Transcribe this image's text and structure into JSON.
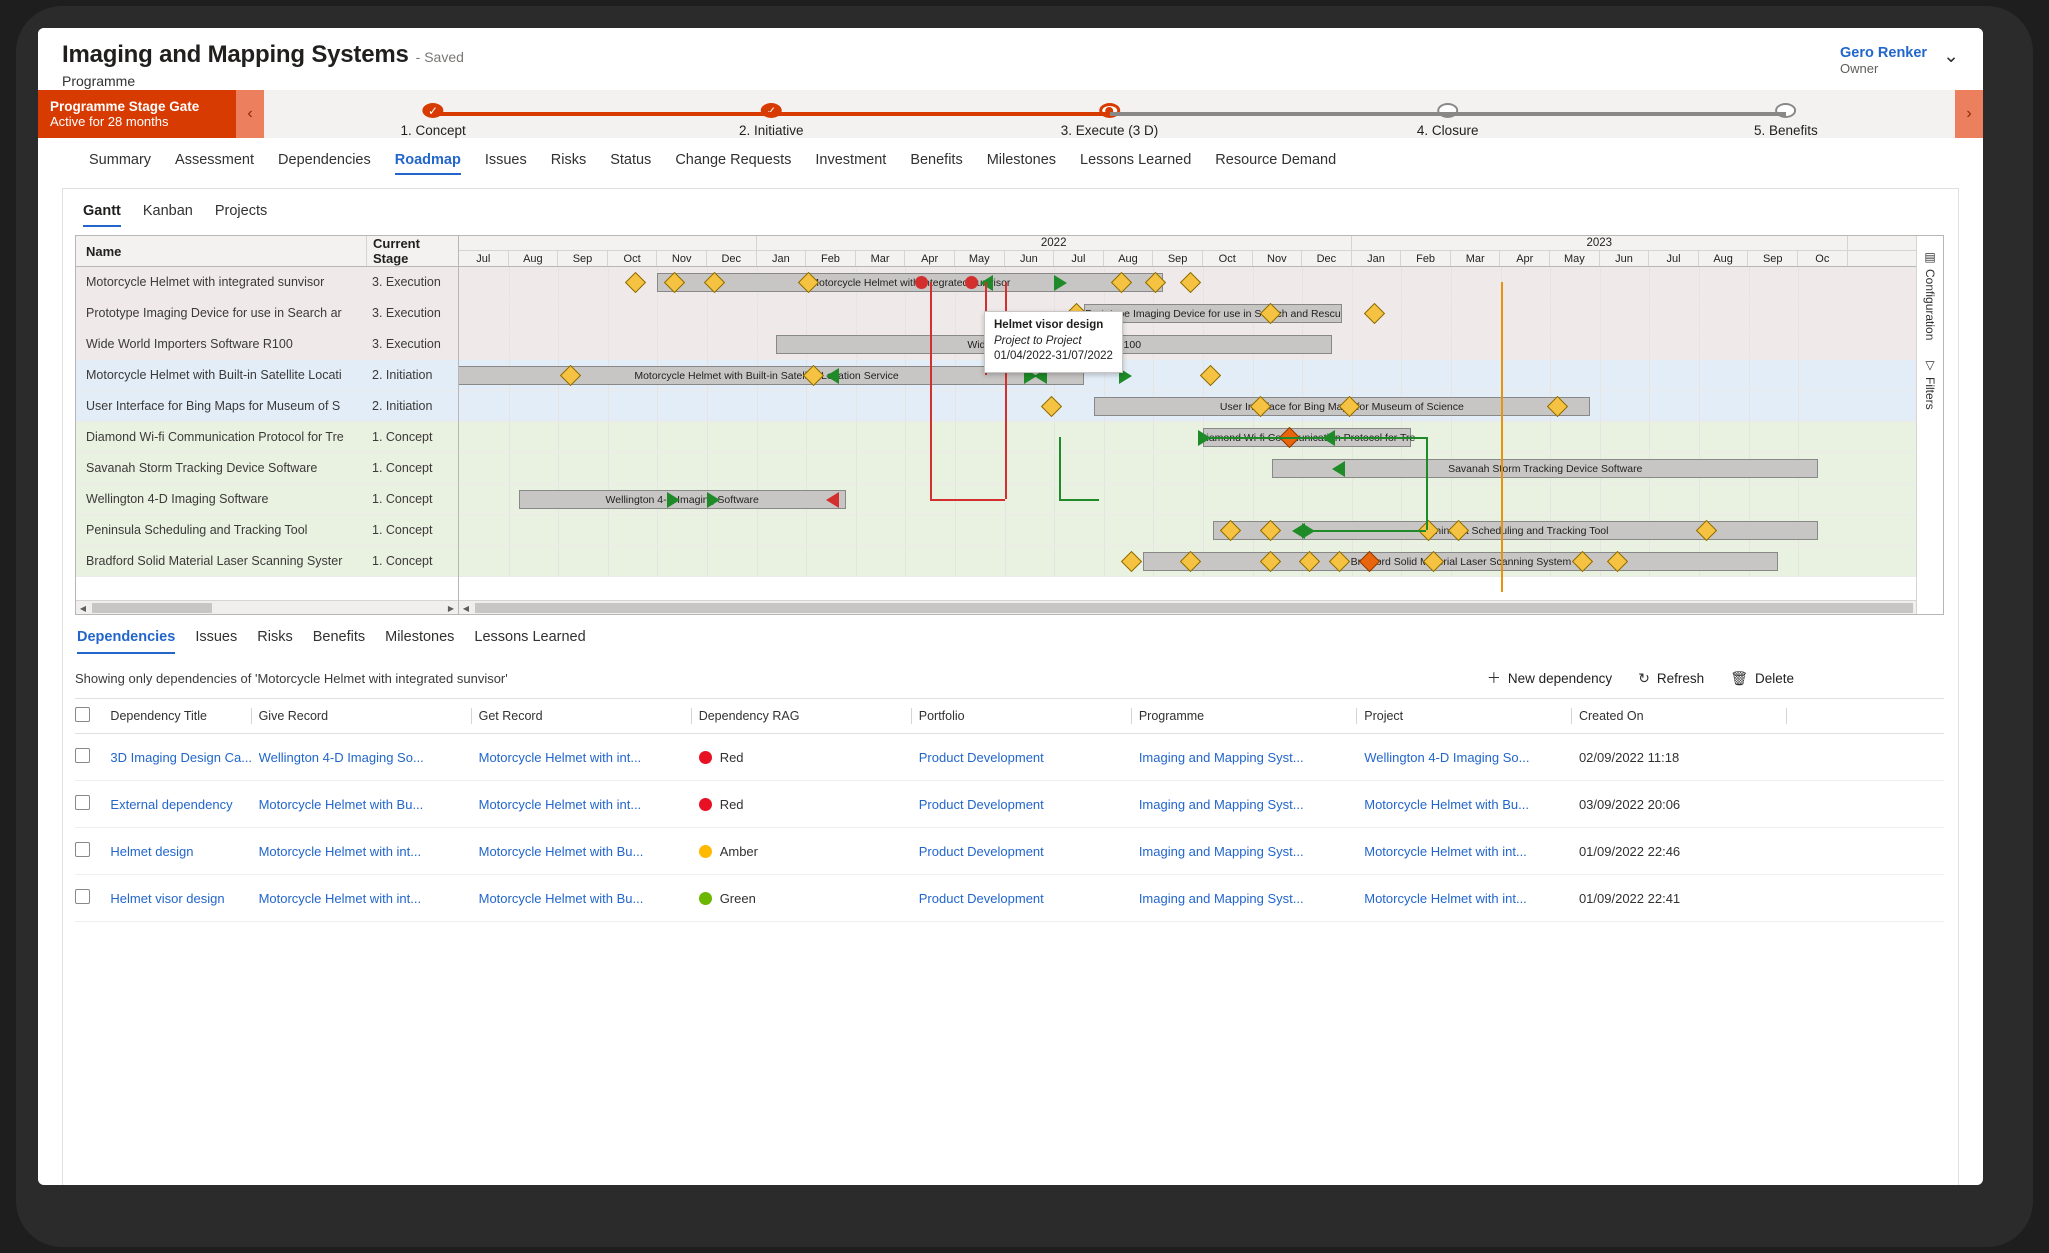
{
  "header": {
    "record_title": "Imaging and Mapping Systems",
    "saved_label": "- Saved",
    "record_type": "Programme",
    "owner_name": "Gero Renker",
    "owner_role": "Owner",
    "owner_chevron": "chevron-down-icon"
  },
  "stage_gate": {
    "label": "Programme Stage Gate",
    "sublabel": "Active for 28 months",
    "prev_icon": "‹",
    "next_icon": "›",
    "stages": [
      {
        "label": "1. Concept",
        "state": "done",
        "glyph": "✓"
      },
      {
        "label": "2. Initiative",
        "state": "done",
        "glyph": "✓"
      },
      {
        "label": "3. Execute  (3 D)",
        "state": "current",
        "glyph": ""
      },
      {
        "label": "4. Closure",
        "state": "todo",
        "glyph": ""
      },
      {
        "label": "5. Benefits",
        "state": "todo",
        "glyph": ""
      }
    ]
  },
  "nav_tabs": [
    {
      "label": "Summary",
      "active": false
    },
    {
      "label": "Assessment",
      "active": false
    },
    {
      "label": "Dependencies",
      "active": false
    },
    {
      "label": "Roadmap",
      "active": true
    },
    {
      "label": "Issues",
      "active": false
    },
    {
      "label": "Risks",
      "active": false
    },
    {
      "label": "Status",
      "active": false
    },
    {
      "label": "Change Requests",
      "active": false
    },
    {
      "label": "Investment",
      "active": false
    },
    {
      "label": "Benefits",
      "active": false
    },
    {
      "label": "Milestones",
      "active": false
    },
    {
      "label": "Lessons Learned",
      "active": false
    },
    {
      "label": "Resource Demand",
      "active": false
    }
  ],
  "roadmap": {
    "view_tabs": [
      {
        "label": "Gantt",
        "active": true
      },
      {
        "label": "Kanban",
        "active": false
      },
      {
        "label": "Projects",
        "active": false
      }
    ],
    "grid_headers": {
      "name": "Name",
      "stage": "Current Stage"
    },
    "rows": [
      {
        "name": "Motorcycle Helmet with integrated sunvisor",
        "stage": "3. Execution",
        "tier": "exec"
      },
      {
        "name": "Prototype Imaging Device for use in Search ar",
        "stage": "3. Execution",
        "tier": "exec"
      },
      {
        "name": "Wide World Importers Software R100",
        "stage": "3. Execution",
        "tier": "exec"
      },
      {
        "name": "Motorcycle Helmet with Built-in Satellite Locati",
        "stage": "2. Initiation",
        "tier": "init"
      },
      {
        "name": "User Interface for Bing Maps for Museum of S",
        "stage": "2. Initiation",
        "tier": "init"
      },
      {
        "name": "Diamond Wi-fi Communication Protocol for Tre",
        "stage": "1. Concept",
        "tier": "conc"
      },
      {
        "name": "Savanah Storm Tracking Device Software",
        "stage": "1. Concept",
        "tier": "conc"
      },
      {
        "name": "Wellington 4-D Imaging Software",
        "stage": "1. Concept",
        "tier": "conc"
      },
      {
        "name": "Peninsula Scheduling and Tracking Tool",
        "stage": "1. Concept",
        "tier": "conc"
      },
      {
        "name": "Bradford Solid Material Laser Scanning Syster",
        "stage": "1. Concept",
        "tier": "conc"
      }
    ],
    "timeline": {
      "years": [
        {
          "label": "",
          "months": 6
        },
        {
          "label": "2022",
          "months": 12
        },
        {
          "label": "2023",
          "months": 10
        }
      ],
      "months": [
        "Jul",
        "Aug",
        "Sep",
        "Oct",
        "Nov",
        "Dec",
        "Jan",
        "Feb",
        "Mar",
        "Apr",
        "May",
        "Jun",
        "Jul",
        "Aug",
        "Sep",
        "Oct",
        "Nov",
        "Dec",
        "Jan",
        "Feb",
        "Mar",
        "Apr",
        "May",
        "Jun",
        "Jul",
        "Aug",
        "Sep",
        "Oc"
      ]
    },
    "bars": [
      {
        "row": 0,
        "start": 4.0,
        "span": 10.2,
        "label": "Motorcycle Helmet with integrated sunvisor"
      },
      {
        "row": 1,
        "start": 12.6,
        "span": 5.2,
        "label": "Prototype Imaging Device for use in Search and Rescu"
      },
      {
        "row": 2,
        "start": 6.4,
        "span": 11.2,
        "label": "Wide World Importers Software R100"
      },
      {
        "row": 3,
        "start": -0.2,
        "span": 12.8,
        "label": "Motorcycle Helmet with Built-in Satellite Location Service"
      },
      {
        "row": 4,
        "start": 12.8,
        "span": 10.0,
        "label": "User Interface for Bing Maps for Museum of Science"
      },
      {
        "row": 5,
        "start": 15.0,
        "span": 4.2,
        "label": "Diamond Wi-fi Communication Protocol for Tre"
      },
      {
        "row": 6,
        "start": 16.4,
        "span": 11.0,
        "label": "Savanah Storm Tracking Device Software"
      },
      {
        "row": 7,
        "start": 1.2,
        "span": 6.6,
        "label": "Wellington 4-D Imaging Software"
      },
      {
        "row": 8,
        "start": 15.2,
        "span": 12.2,
        "label": "Peninsula Scheduling and Tracking Tool"
      },
      {
        "row": 9,
        "start": 13.8,
        "span": 12.8,
        "label": "Bradford Solid Material Laser Scanning System"
      }
    ],
    "tooltip": {
      "title": "Helmet visor design",
      "type": "Project to Project",
      "dates": "01/04/2022-31/07/2022"
    },
    "side_rail": [
      {
        "label": "Configuration",
        "icon": "table-icon"
      },
      {
        "label": "Filters",
        "icon": "funnel-icon"
      }
    ]
  },
  "lower": {
    "tabs": [
      {
        "label": "Dependencies",
        "active": true
      },
      {
        "label": "Issues",
        "active": false
      },
      {
        "label": "Risks",
        "active": false
      },
      {
        "label": "Benefits",
        "active": false
      },
      {
        "label": "Milestones",
        "active": false
      },
      {
        "label": "Lessons Learned",
        "active": false
      }
    ],
    "filter_note": "Showing only dependencies of 'Motorcycle Helmet with integrated sunvisor'",
    "commands": [
      {
        "label": "New dependency",
        "icon": "plus-icon"
      },
      {
        "label": "Refresh",
        "icon": "refresh-icon"
      },
      {
        "label": "Delete",
        "icon": "trash-icon"
      }
    ],
    "table": {
      "columns": [
        "Dependency Title",
        "Give Record",
        "Get Record",
        "Dependency RAG",
        "Portfolio",
        "Programme",
        "Project",
        "Created On"
      ],
      "rows": [
        {
          "title": "3D Imaging Design Ca...",
          "give": "Wellington 4-D Imaging So...",
          "get": "Motorcycle Helmet with int...",
          "rag": "Red",
          "rag_color": "#e81123",
          "portfolio": "Product Development",
          "programme": "Imaging and Mapping Syst...",
          "project": "Wellington 4-D Imaging So...",
          "created": "02/09/2022 11:18"
        },
        {
          "title": "External dependency",
          "give": "Motorcycle Helmet with Bu...",
          "get": "Motorcycle Helmet with int...",
          "rag": "Red",
          "rag_color": "#e81123",
          "portfolio": "Product Development",
          "programme": "Imaging and Mapping Syst...",
          "project": "Motorcycle Helmet with Bu...",
          "created": "03/09/2022 20:06"
        },
        {
          "title": "Helmet design",
          "give": "Motorcycle Helmet with int...",
          "get": "Motorcycle Helmet with Bu...",
          "rag": "Amber",
          "rag_color": "#ffb900",
          "portfolio": "Product Development",
          "programme": "Imaging and Mapping Syst...",
          "project": "Motorcycle Helmet with int...",
          "created": "01/09/2022 22:46"
        },
        {
          "title": "Helmet visor design",
          "give": "Motorcycle Helmet with int...",
          "get": "Motorcycle Helmet with Bu...",
          "rag": "Green",
          "rag_color": "#6bb700",
          "portfolio": "Product Development",
          "programme": "Imaging and Mapping Syst...",
          "project": "Motorcycle Helmet with int...",
          "created": "01/09/2022 22:41"
        }
      ]
    }
  },
  "colors": {
    "accent_orange": "#d83b01",
    "link_blue": "#2266cc",
    "tier_exec": "#efe9e9",
    "tier_init": "#e3edf7",
    "tier_conc": "#e9f1e1"
  }
}
